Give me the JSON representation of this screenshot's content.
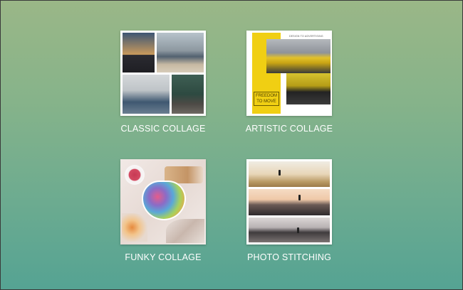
{
  "options": [
    {
      "id": "classic",
      "label": "CLASSIC COLLAGE"
    },
    {
      "id": "artistic",
      "label": "ARTISTIC COLLAGE",
      "thumbnail_text": "FREEDOM TO MOVE",
      "thumbnail_small_text": "DESIGN TO ADVERTISING"
    },
    {
      "id": "funky",
      "label": "FUNKY COLLAGE"
    },
    {
      "id": "stitch",
      "label": "PHOTO STITCHING"
    }
  ]
}
